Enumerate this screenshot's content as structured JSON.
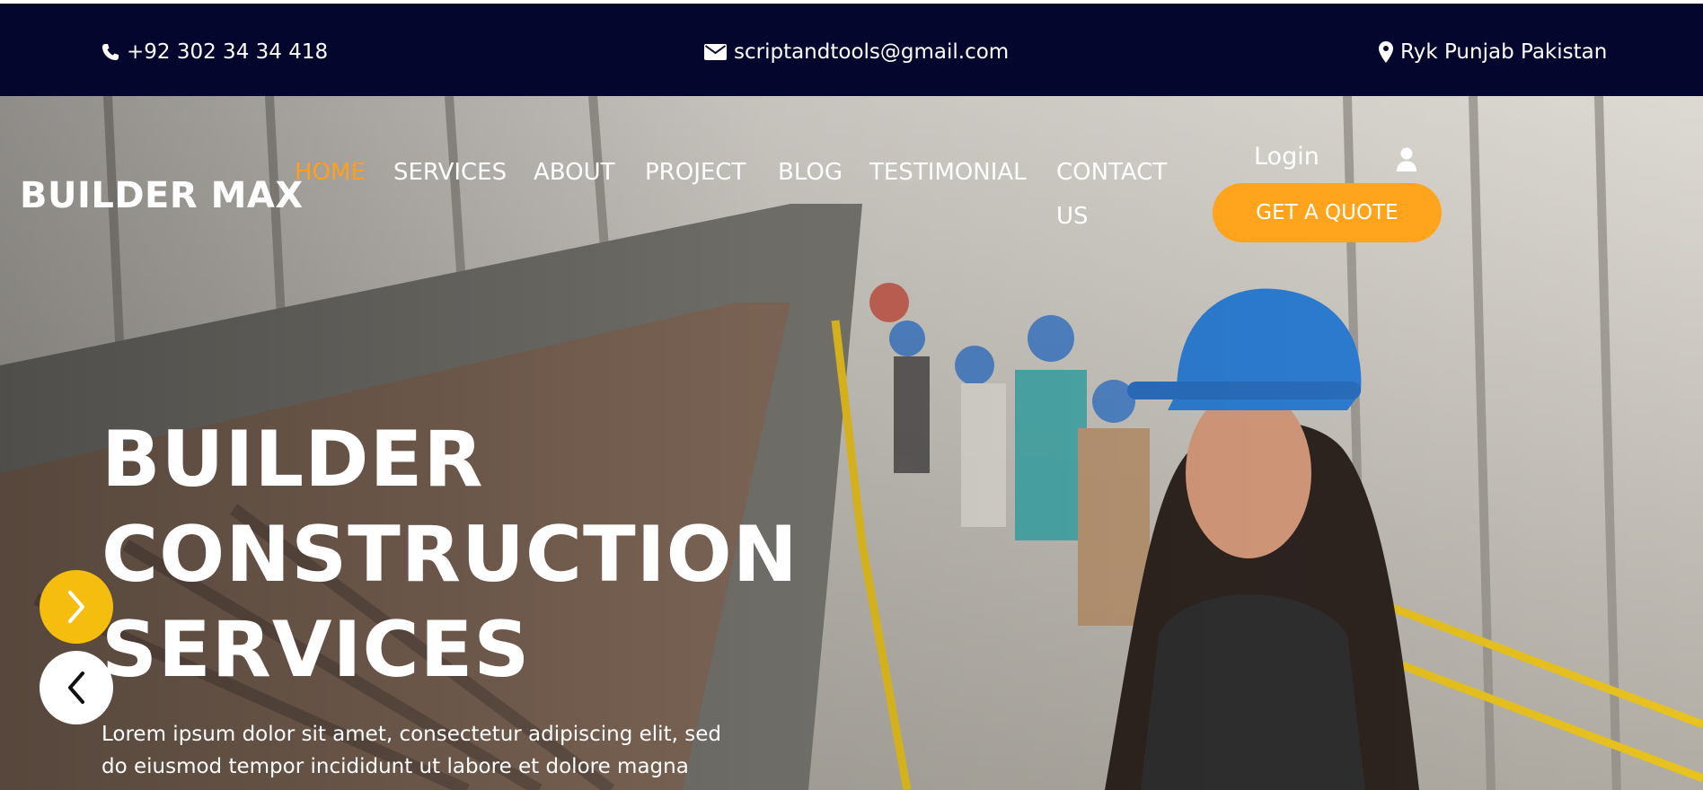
{
  "topbar": {
    "phone": "+92 302 34 34 418",
    "email": "scriptandtools@gmail.com",
    "location": "Ryk Punjab Pakistan",
    "icons": [
      "phone-icon",
      "envelope-icon",
      "map-marker-icon"
    ]
  },
  "header": {
    "logo": "BUILDER MAX",
    "nav": [
      {
        "label": "HOME",
        "active": true
      },
      {
        "label": "SERVICES"
      },
      {
        "label": "ABOUT"
      },
      {
        "label": "PROJECT"
      },
      {
        "label": "BLOG"
      },
      {
        "label": "TESTIMONIAL"
      },
      {
        "label": "CONTACT"
      },
      {
        "label": "US"
      }
    ],
    "login_label": "Login",
    "quote_label": "GET A QUOTE"
  },
  "hero": {
    "title_lines": [
      "BUILDER",
      "CONSTRUCTION",
      "SERVICES"
    ],
    "text_lines": [
      "Lorem ipsum dolor sit amet, consectetur adipiscing elit, sed",
      "do eiusmod tempor incididunt ut labore et dolore magna"
    ]
  },
  "colors": {
    "topbar_bg": "#04062e",
    "accent_orange": "#ffa41c",
    "active_nav": "#ff9f1c",
    "slider_yellow": "#f5bd0e"
  }
}
